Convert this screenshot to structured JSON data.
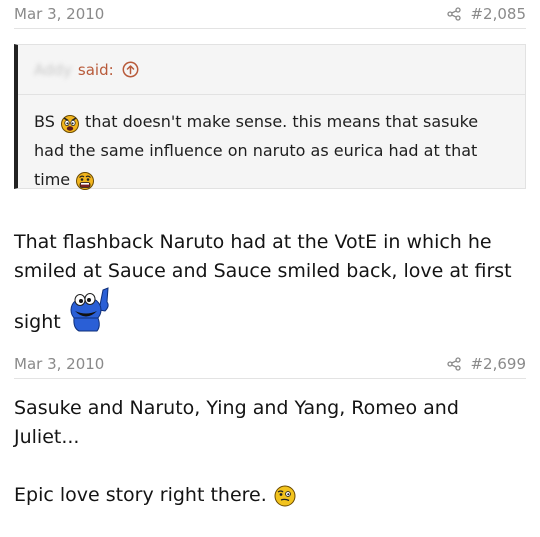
{
  "post1": {
    "date": "Mar 3, 2010",
    "number": "#2,085",
    "quote": {
      "author": "Addy",
      "said": "said:",
      "text_bs": "BS",
      "text_main": "that doesn't make sense. this means that sasuke had the same influence on naruto as eurica had at that",
      "text_end": "time"
    },
    "message": {
      "text": "That flashback Naruto had at the VotE in which he smiled at Sauce and Sauce smiled back, love at first",
      "text_end": "sight"
    }
  },
  "post2": {
    "date": "Mar 3, 2010",
    "number": "#2,699",
    "line1": "Sasuke and Naruto, Ying and Yang, Romeo and Juliet...",
    "line2": "Epic love story right there."
  },
  "colors": {
    "quote_attribution": "#b85a3a",
    "quote_border": "#222222",
    "meta_text": "#8a8a8a",
    "cookie_monster_blue": "#2a5fd6"
  },
  "icons": [
    "share-icon",
    "quote-jump-icon",
    "angry-emoji-icon",
    "scared-emoji-icon",
    "cookie-monster-emoji-icon",
    "thinking-emoji-icon"
  ]
}
